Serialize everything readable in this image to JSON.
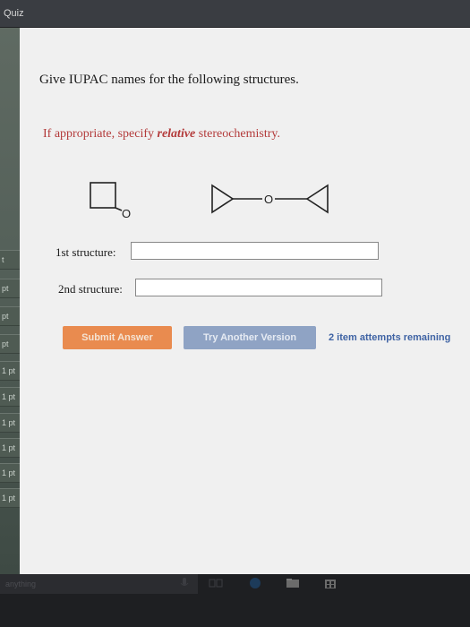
{
  "window": {
    "title": "Quiz"
  },
  "sidebar": {
    "items": [
      {
        "label": "t"
      },
      {
        "label": "pt"
      },
      {
        "label": "pt"
      },
      {
        "label": "pt"
      },
      {
        "label": "1 pt"
      },
      {
        "label": "1 pt"
      },
      {
        "label": "1 pt"
      },
      {
        "label": "1 pt"
      },
      {
        "label": "1 pt"
      },
      {
        "label": "1 pt"
      }
    ]
  },
  "question": {
    "heading": "Give IUPAC names for the following structures.",
    "instruction_prefix": "If appropriate, specify ",
    "instruction_emphasis": "relative",
    "instruction_suffix": " stereochemistry.",
    "structures": [
      {
        "name": "cyclobutyl-oxygen structure",
        "atom_label": "O"
      },
      {
        "name": "cyclopropyl ether structure",
        "atom_label": "O"
      }
    ]
  },
  "answers": {
    "first": {
      "label": "1st structure:",
      "value": ""
    },
    "second": {
      "label": "2nd structure:",
      "value": ""
    }
  },
  "actions": {
    "submit_label": "Submit Answer",
    "try_label": "Try Another Version",
    "attempts_text": "2 item attempts remaining"
  },
  "taskbar": {
    "search_text": "anything",
    "icons": [
      "microphone-icon",
      "task-view-icon",
      "edge-icon",
      "file-explorer-icon",
      "store-icon"
    ]
  },
  "colors": {
    "instruction": "#b33a3a",
    "submit": "#e98b4f",
    "try_another": "#8fa3c4",
    "attempts": "#3f63a4"
  }
}
